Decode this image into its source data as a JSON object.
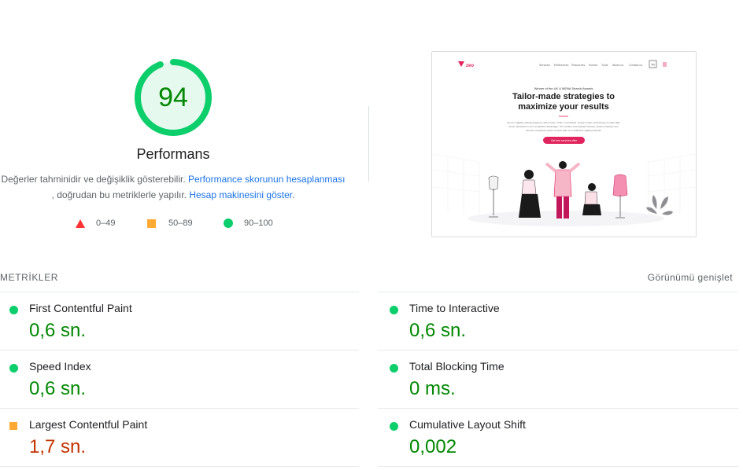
{
  "score": {
    "value": "94",
    "fraction": 0.94,
    "color": "#0cce6b",
    "text_color": "#008800",
    "title": "Performans"
  },
  "description": {
    "text1": "Değerler tahminidir ve değişiklik gösterebilir. ",
    "link1": "Performance skorunun hesaplanması",
    "text2": " , doğrudan bu metriklerle yapılır. ",
    "link2": "Hesap makinesini göster",
    "text3": "."
  },
  "legend": [
    {
      "shape": "triangle",
      "label": "0–49",
      "color": "#ff3333"
    },
    {
      "shape": "square",
      "label": "50–89",
      "color": "#ffaa33"
    },
    {
      "shape": "circle",
      "label": "90–100",
      "color": "#0cce6b"
    }
  ],
  "thumbnail": {
    "logo": "zeo",
    "nav": [
      "Services",
      "References",
      "Resources",
      "Events",
      "Tools",
      "About us",
      "Contact us"
    ],
    "lang": "TR",
    "kicker": "Winner of the UK & MENA Search Awards",
    "headline1": "Tailor-made strategies to",
    "headline2": "maximize your results",
    "body1": "Zeo is a digital marketing agency with a team of 50+ consultants. Using modern technology to make data",
    "body2": "driven decisions is our competitive advantage. The world's most popular brands, mission startups and",
    "body3": "internet companies prefer to work with us to fulfill their digital potential.",
    "cta": "Get free services offer"
  },
  "metrics": {
    "section_label": "METRİKLER",
    "expand_label": "Görünümü genişlet",
    "left": [
      {
        "name": "First Contentful Paint",
        "value": "0,6 sn.",
        "rating": "good"
      },
      {
        "name": "Speed Index",
        "value": "0,6 sn.",
        "rating": "good"
      },
      {
        "name": "Largest Contentful Paint",
        "value": "1,7 sn.",
        "rating": "average"
      }
    ],
    "right": [
      {
        "name": "Time to Interactive",
        "value": "0,6 sn.",
        "rating": "good"
      },
      {
        "name": "Total Blocking Time",
        "value": "0 ms.",
        "rating": "good"
      },
      {
        "name": "Cumulative Layout Shift",
        "value": "0,002",
        "rating": "good"
      }
    ]
  }
}
